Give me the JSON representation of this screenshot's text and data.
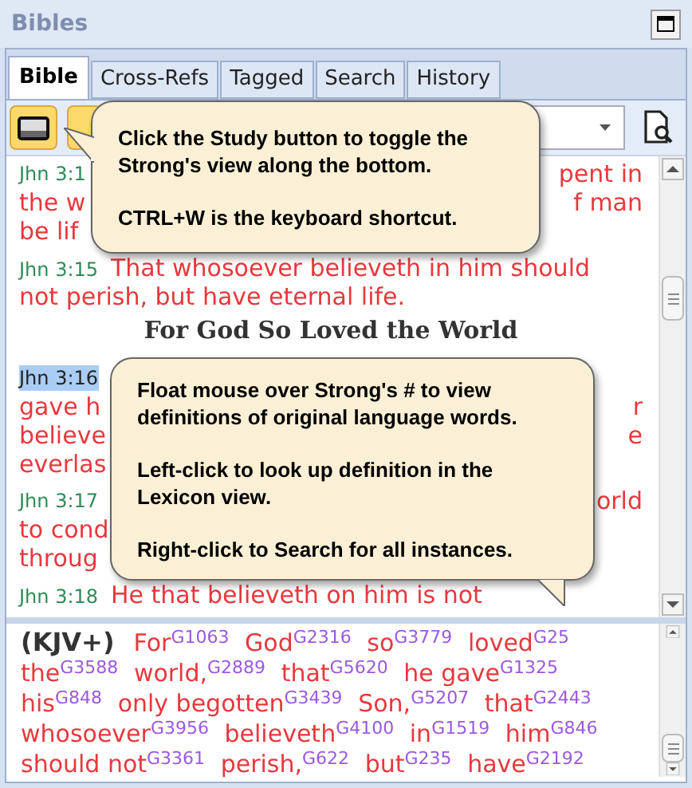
{
  "panel": {
    "title": "Bibles"
  },
  "tabs": [
    {
      "label": "Bible",
      "selected": true
    },
    {
      "label": "Cross-Refs",
      "selected": false
    },
    {
      "label": "Tagged",
      "selected": false
    },
    {
      "label": "Search",
      "selected": false
    },
    {
      "label": "History",
      "selected": false
    }
  ],
  "toolbar": {
    "study_button": {
      "on": true
    }
  },
  "verses": [
    {
      "kind": "line",
      "ref": "Jhn 3:1",
      "right": "pent in",
      "ref_selected": false
    },
    {
      "kind": "line",
      "left": "the w",
      "right": "f man"
    },
    {
      "kind": "line",
      "left": "be lif"
    },
    {
      "kind": "line",
      "ref": "Jhn 3:15",
      "left": "That whosoever believeth in him should",
      "ref_selected": false
    },
    {
      "kind": "line",
      "left": "not perish, but have eternal life."
    },
    {
      "kind": "heading",
      "text": "For God So Loved the World"
    },
    {
      "kind": "line",
      "ref": "Jhn 3:16",
      "ref_selected": true
    },
    {
      "kind": "line",
      "left": "gave h",
      "right": "r"
    },
    {
      "kind": "line",
      "left": "believe",
      "right": "e"
    },
    {
      "kind": "line",
      "left": "everlas"
    },
    {
      "kind": "line",
      "ref": "Jhn 3:17",
      "right": "orld",
      "ref_selected": false
    },
    {
      "kind": "line",
      "left": "to cond"
    },
    {
      "kind": "line",
      "left": "throug"
    },
    {
      "kind": "line",
      "ref": "Jhn 3:18",
      "left": "He that believeth on him is not",
      "ref_selected": false
    }
  ],
  "callouts": [
    {
      "paragraphs": [
        "Click the Study button to toggle the Strong's view along the bottom.",
        "CTRL+W is the keyboard shortcut."
      ]
    },
    {
      "paragraphs": [
        "Float mouse over Strong's # to view definitions of original language words.",
        "Left-click to look up definition in the Lexicon view.",
        "Right-click to Search for all instances."
      ]
    }
  ],
  "strongs": {
    "version": "(KJV+)",
    "words": [
      {
        "word": "For",
        "code": "G1063"
      },
      {
        "word": "God",
        "code": "G2316"
      },
      {
        "word": "so",
        "code": "G3779"
      },
      {
        "word": "loved",
        "code": "G25"
      },
      {
        "word": "the",
        "code": "G3588"
      },
      {
        "word": "world,",
        "code": "G2889"
      },
      {
        "word": "that",
        "code": "G5620"
      },
      {
        "word": "he gave",
        "code": "G1325"
      },
      {
        "word": "his",
        "code": "G848"
      },
      {
        "word": "only begotten",
        "code": "G3439"
      },
      {
        "word": "Son,",
        "code": "G5207"
      },
      {
        "word": "that",
        "code": "G2443"
      },
      {
        "word": "whosoever",
        "code": "G3956"
      },
      {
        "word": "believeth",
        "code": "G4100"
      },
      {
        "word": "in",
        "code": "G1519"
      },
      {
        "word": "him",
        "code": "G846"
      },
      {
        "word": "should not",
        "code": "G3361"
      },
      {
        "word": "perish,",
        "code": "G622"
      },
      {
        "word": "but",
        "code": "G235"
      },
      {
        "word": "have",
        "code": "G2192"
      }
    ]
  }
}
